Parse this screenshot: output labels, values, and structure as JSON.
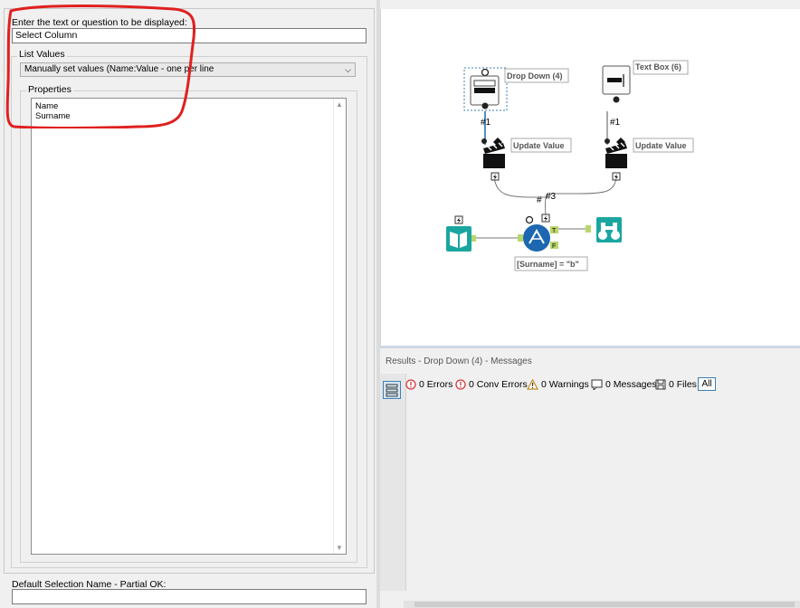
{
  "config": {
    "question_label": "Enter the text or question to be displayed:",
    "question_value": "Select Column",
    "list_values_label": "List Values",
    "dropdown_value": "Manually set values (Name:Value - one per line",
    "properties_label": "Properties",
    "properties_lines": [
      "Name",
      "Surname"
    ],
    "default_label": "Default Selection Name - Partial OK:",
    "default_value": ""
  },
  "canvas": {
    "nodes": {
      "dropdown": "Drop Down (4)",
      "textbox": "Text Box (6)",
      "update1": "Update Value",
      "update2": "Update Value",
      "filter_expr": "[Surname] = \"b\""
    },
    "connection_labels": {
      "c1": "#1",
      "c2": "#1",
      "c3": "#3",
      "c4": "#"
    },
    "filter_ports": {
      "true": "T",
      "false": "F"
    }
  },
  "results": {
    "title": "Results - Drop Down (4) - Messages",
    "errors": "0 Errors",
    "conv_errors": "0 Conv Errors",
    "warnings": "0 Warnings",
    "messages": "0 Messages",
    "files": "0 Files",
    "all": "All"
  },
  "colors": {
    "accent": "#3c7fb1",
    "annotation_red": "#e02020",
    "tool_teal": "#1aa6a0",
    "filter_blue": "#1c67b0"
  }
}
